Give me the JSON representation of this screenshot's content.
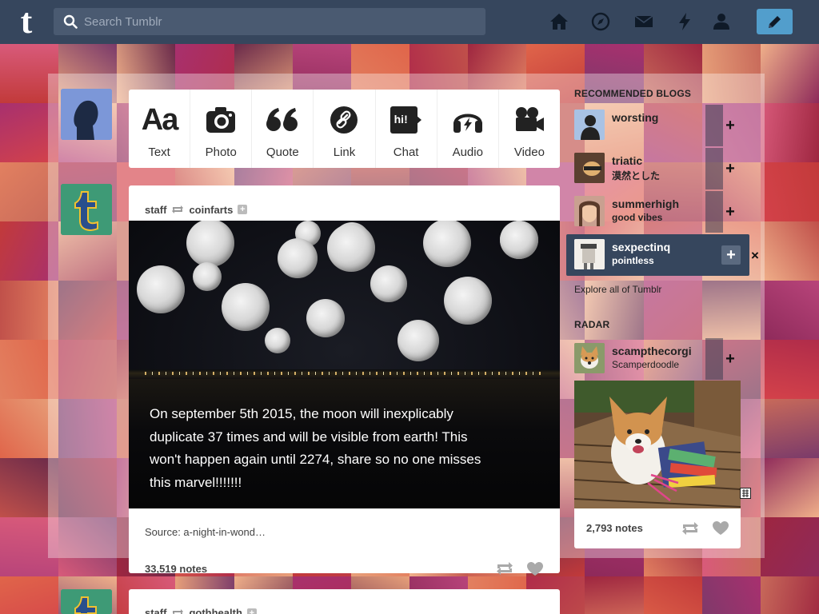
{
  "app": {
    "logo_text": "t",
    "brand_color": "#36465d",
    "accent_color": "#529ecc"
  },
  "search": {
    "placeholder": "Search Tumblr"
  },
  "nav": {
    "icons": [
      "home-icon",
      "explore-icon",
      "inbox-icon",
      "activity-icon",
      "account-icon"
    ],
    "compose_icon": "pencil-icon"
  },
  "post_types": [
    {
      "label": "Text",
      "glyph": "Aa"
    },
    {
      "label": "Photo",
      "glyph": "camera"
    },
    {
      "label": "Quote",
      "glyph": "66"
    },
    {
      "label": "Link",
      "glyph": "link"
    },
    {
      "label": "Chat",
      "glyph": "hi!"
    },
    {
      "label": "Audio",
      "glyph": "headphones"
    },
    {
      "label": "Video",
      "glyph": "video-camera"
    }
  ],
  "post": {
    "author": "staff",
    "reblogged_from": "coinfarts",
    "caption": "On september 5th 2015, the moon will inexplicably duplicate 37 times and will be visible from earth! This won't happen again until 2274, share so no one misses this marvel!!!!!!!",
    "source": "Source: a-night-in-wond…",
    "notes": "33,519 notes"
  },
  "post2": {
    "author": "staff",
    "reblogged_from": "gothhealth"
  },
  "sidebar": {
    "recommended_heading": "RECOMMENDED BLOGS",
    "blogs": [
      {
        "name": "worsting",
        "title": ""
      },
      {
        "name": "triatic",
        "title": "漠然とした"
      },
      {
        "name": "summerhigh",
        "title": "good vibes"
      },
      {
        "name": "sexpectinq",
        "title": "pointless"
      }
    ],
    "explore_link": "Explore all of Tumblr",
    "radar_heading": "RADAR",
    "radar_blog": {
      "name": "scampthecorgi",
      "title": "Scamperdoodle"
    },
    "radar_notes": "2,793 notes"
  }
}
